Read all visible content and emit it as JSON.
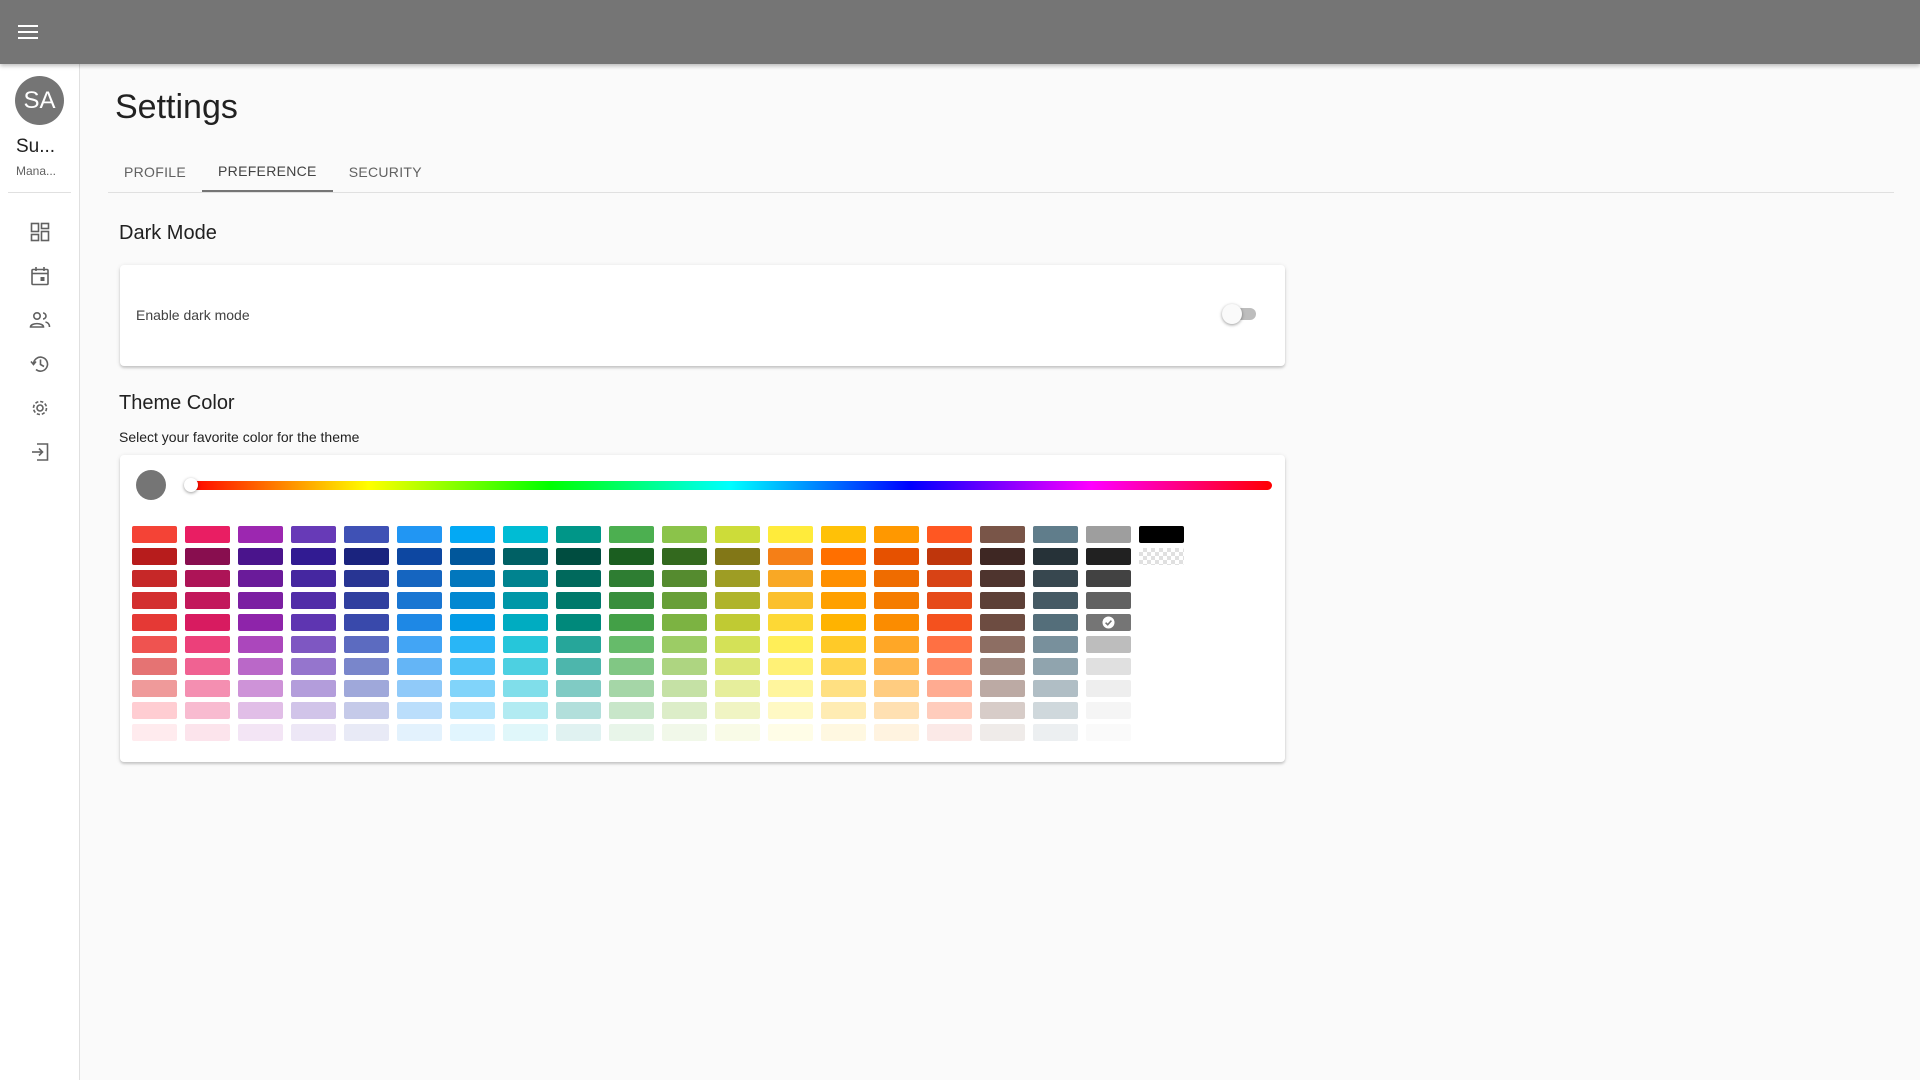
{
  "app": {
    "menu_icon": "menu-icon"
  },
  "user": {
    "initials": "SA",
    "name": "Su...",
    "role": "Mana..."
  },
  "nav": [
    {
      "icon": "dashboard-icon"
    },
    {
      "icon": "calendar-icon"
    },
    {
      "icon": "people-icon"
    },
    {
      "icon": "history-icon"
    },
    {
      "icon": "settings-icon"
    },
    {
      "icon": "logout-icon"
    }
  ],
  "page": {
    "title": "Settings"
  },
  "tabs": [
    {
      "label": "PROFILE",
      "active": false
    },
    {
      "label": "PREFERENCE",
      "active": true
    },
    {
      "label": "SECURITY",
      "active": false
    }
  ],
  "dark_mode": {
    "title": "Dark Mode",
    "label": "Enable dark mode",
    "enabled": false
  },
  "theme": {
    "title": "Theme Color",
    "subtitle": "Select your favorite color for the theme",
    "current_color": "#757575",
    "hue": 0,
    "selected_swatch": "#757575",
    "palette": [
      [
        "#F44336",
        "#B71C1C",
        "#C62828",
        "#D32F2F",
        "#E53935",
        "#EF5350",
        "#E57373",
        "#EF9A9A",
        "#FFCDD2",
        "#FFEBEE"
      ],
      [
        "#E91E63",
        "#880E4F",
        "#AD1457",
        "#C2185B",
        "#D81B60",
        "#EC407A",
        "#F06292",
        "#F48FB1",
        "#F8BBD0",
        "#FCE4EC"
      ],
      [
        "#9C27B0",
        "#4A148C",
        "#6A1B9A",
        "#7B1FA2",
        "#8E24AA",
        "#AB47BC",
        "#BA68C8",
        "#CE93D8",
        "#E1BEE7",
        "#F3E5F5"
      ],
      [
        "#673AB7",
        "#311B92",
        "#4527A0",
        "#512DA8",
        "#5E35B1",
        "#7E57C2",
        "#9575CD",
        "#B39DDB",
        "#D1C4E9",
        "#EDE7F6"
      ],
      [
        "#3F51B5",
        "#1A237E",
        "#283593",
        "#303F9F",
        "#3949AB",
        "#5C6BC0",
        "#7986CB",
        "#9FA8DA",
        "#C5CAE9",
        "#E8EAF6"
      ],
      [
        "#2196F3",
        "#0D47A1",
        "#1565C0",
        "#1976D2",
        "#1E88E5",
        "#42A5F5",
        "#64B5F6",
        "#90CAF9",
        "#BBDEFB",
        "#E3F2FD"
      ],
      [
        "#03A9F4",
        "#01579B",
        "#0277BD",
        "#0288D1",
        "#039BE5",
        "#29B6F6",
        "#4FC3F7",
        "#81D4FA",
        "#B3E5FC",
        "#E1F5FE"
      ],
      [
        "#00BCD4",
        "#006064",
        "#00838F",
        "#0097A7",
        "#00ACC1",
        "#26C6DA",
        "#4DD0E1",
        "#80DEEA",
        "#B2EBF2",
        "#E0F7FA"
      ],
      [
        "#009688",
        "#004D40",
        "#00695C",
        "#00796B",
        "#00897B",
        "#26A69A",
        "#4DB6AC",
        "#80CBC4",
        "#B2DFDB",
        "#E0F2F1"
      ],
      [
        "#4CAF50",
        "#1B5E20",
        "#2E7D32",
        "#388E3C",
        "#43A047",
        "#66BB6A",
        "#81C784",
        "#A5D6A7",
        "#C8E6C9",
        "#E8F5E9"
      ],
      [
        "#8BC34A",
        "#33691E",
        "#558B2F",
        "#689F38",
        "#7CB342",
        "#9CCC65",
        "#AED581",
        "#C5E1A5",
        "#DCEDC8",
        "#F1F8E9"
      ],
      [
        "#CDDC39",
        "#827717",
        "#9E9D24",
        "#AFB42B",
        "#C0CA33",
        "#D4E157",
        "#DCE775",
        "#E6EE9C",
        "#F0F4C3",
        "#F9FBE7"
      ],
      [
        "#FFEB3B",
        "#F57F17",
        "#F9A825",
        "#FBC02D",
        "#FDD835",
        "#FFEE58",
        "#FFF176",
        "#FFF59D",
        "#FFF9C4",
        "#FFFDE7"
      ],
      [
        "#FFC107",
        "#FF6F00",
        "#FF8F00",
        "#FFA000",
        "#FFB300",
        "#FFCA28",
        "#FFD54F",
        "#FFE082",
        "#FFECB3",
        "#FFF8E1"
      ],
      [
        "#FF9800",
        "#E65100",
        "#EF6C00",
        "#F57C00",
        "#FB8C00",
        "#FFA726",
        "#FFB74D",
        "#FFCC80",
        "#FFE0B2",
        "#FFF3E0"
      ],
      [
        "#FF5722",
        "#BF360C",
        "#D84315",
        "#E64A19",
        "#F4511E",
        "#FF7043",
        "#FF8A65",
        "#FFAB91",
        "#FFCCBC",
        "#FBE9E7"
      ],
      [
        "#795548",
        "#3E2723",
        "#4E342E",
        "#5D4037",
        "#6D4C41",
        "#8D6E63",
        "#A1887F",
        "#BCAAA4",
        "#D7CCC8",
        "#EFEBE9"
      ],
      [
        "#607D8B",
        "#263238",
        "#37474F",
        "#455A64",
        "#546E7A",
        "#78909C",
        "#90A4AE",
        "#B0BEC5",
        "#CFD8DC",
        "#ECEFF1"
      ],
      [
        "#9E9E9E",
        "#212121",
        "#424242",
        "#616161",
        "#757575",
        "#BDBDBD",
        "#E0E0E0",
        "#EEEEEE",
        "#F5F5F5",
        "#FAFAFA"
      ],
      [
        "#000000",
        "transparent"
      ]
    ]
  }
}
